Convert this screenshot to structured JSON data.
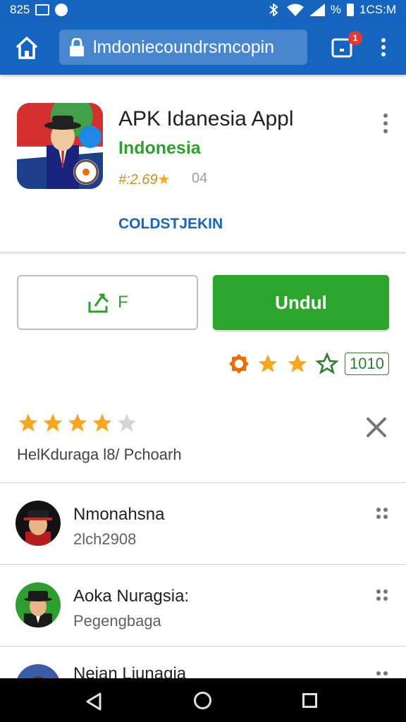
{
  "status_bar": {
    "time_left": "825",
    "time_right": "1CS:M",
    "battery_pct": "%"
  },
  "browser": {
    "url": "lmdoniecoundrsmcopin",
    "tab_badge": "1"
  },
  "app": {
    "title": "APK Idanesia Appl",
    "developer": "Indonesia",
    "rating_text": "#:2.69",
    "rating_star": "★",
    "count": "04",
    "link": "COLDSTJEKIN"
  },
  "actions": {
    "share_label": "F",
    "install_label": "Undul"
  },
  "mini_rating": {
    "stars_filled": 2,
    "count": "1010"
  },
  "review_summary": {
    "stars": 4,
    "text": "HelKduraga l8/ Pchoarh"
  },
  "list": [
    {
      "name": "Nmonahsna",
      "sub": "2lch2908"
    },
    {
      "name": "Aoka Nuragsia:",
      "sub": "Pegengbaga"
    },
    {
      "name": "Neian Liunagia",
      "sub": ""
    }
  ],
  "colors": {
    "brand_blue": "#1565c0",
    "install_green": "#2ca52c",
    "star_gold": "#f5a623"
  }
}
